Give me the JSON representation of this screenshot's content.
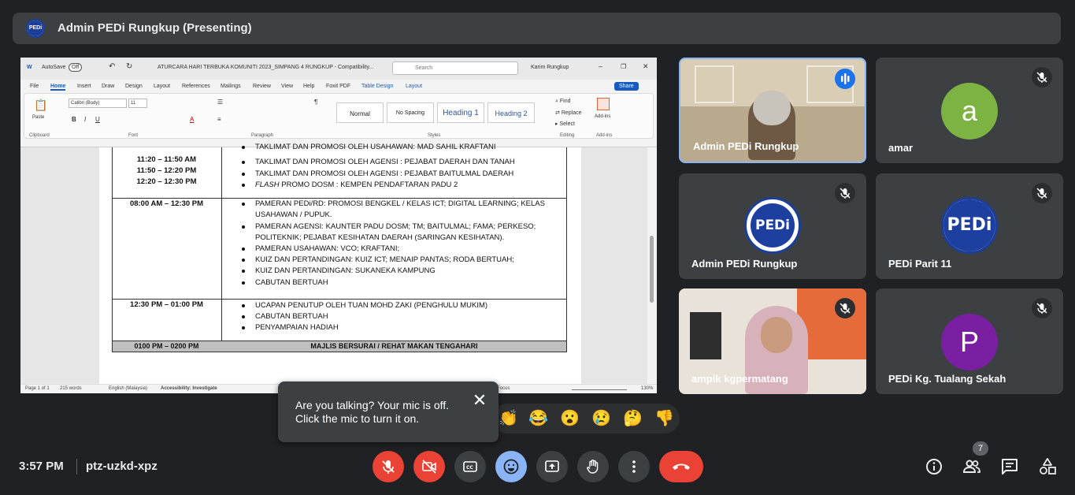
{
  "presenter_bar": {
    "logo_text": "PEDi",
    "title": "Admin PEDi Rungkup (Presenting)"
  },
  "word": {
    "autosave_label": "AutoSave",
    "autosave_state": "Off",
    "doc_title": "ATURCARA HARI TERBUKA KOMUNITI 2023_SIMPANG 4 RUNGKUP  -  Compatibility...",
    "search_placeholder": "Search",
    "user": "Karim Rungkup",
    "menu": [
      "File",
      "Home",
      "Insert",
      "Draw",
      "Design",
      "Layout",
      "References",
      "Mailings",
      "Review",
      "View",
      "Help",
      "Foxit PDF",
      "Table Design",
      "Layout"
    ],
    "share_label": "Share",
    "font_name": "Calibri (Body)",
    "font_size": "11",
    "paste_label": "Paste",
    "styles": [
      "Normal",
      "No Spacing",
      "Heading 1",
      "Heading 2"
    ],
    "find_label": "Find",
    "replace_label": "Replace",
    "select_label": "Select",
    "addins_label": "Add-ins",
    "groups": [
      "Clipboard",
      "Font",
      "Paragraph",
      "Styles",
      "Editing",
      "Add-ins"
    ],
    "rows": [
      {
        "times": [
          "11:20 – 11:50 AM",
          "11:50 – 12:20 PM",
          "12:20 – 12:30 PM"
        ],
        "items": [
          "TAKLIMAT DAN PROMOSI OLEH USAHAWAN: MAD SAHIL KRAFTANI",
          "TAKLIMAT DAN PROMOSI OLEH AGENSI : PEJABAT DAERAH DAN TANAH",
          "TAKLIMAT DAN PROMOSI OLEH AGENSI : PEJABAT BAITULMAL DAERAH",
          "PROMO DOSM : KEMPEN PENDAFTARAN PADU 2"
        ],
        "italic_prefix": "FLASH"
      },
      {
        "times": [
          "08:00 AM – 12:30 PM"
        ],
        "items": [
          "PAMERAN PEDi/RD: PROMOSI BENGKEL / KELAS ICT; DIGITAL LEARNING; KELAS",
          "USAHAWAN / PUPUK.",
          "PAMERAN AGENSI: KAUNTER PADU DOSM; TM; BAITULMAL; FAMA; PERKESO;",
          "POLITEKNIK; PEJABAT KESIHATAN DAERAH (SARINGAN KESIHATAN).",
          "PAMERAN USAHAWAN: VCO; KRAFTANI;",
          "KUIZ DAN PERTANDINGAN: KUIZ ICT; MENAIP PANTAS; RODA BERTUAH;",
          "KUIZ DAN PERTANDINGAN: SUKANEKA KAMPUNG",
          "CABUTAN BERTUAH"
        ]
      },
      {
        "times": [
          "12:30 PM – 01:00 PM"
        ],
        "items": [
          "UCAPAN PENUTUP OLEH TUAN MOHD ZAKI (PENGHULU MUKIM)",
          "CABUTAN BERTUAH",
          "PENYAMPAIAN HADIAH"
        ]
      },
      {
        "times": [
          "0100 PM – 0200 PM"
        ],
        "items": [
          "MAJLIS BERSURAI / REHAT MAKAN TENGAHARI"
        ]
      }
    ],
    "status": {
      "page": "Page 1 of 1",
      "words": "215 words",
      "language": "English (Malaysia)",
      "accessibility": "Accessibility: Investigate",
      "focus": "Focus",
      "zoom": "130%"
    }
  },
  "participants": [
    {
      "name": "Admin PEDi Rungkup",
      "type": "video",
      "speaking": true
    },
    {
      "name": "amar",
      "type": "avatar",
      "initial": "a",
      "color": "#7cb342"
    },
    {
      "name": "Admin PEDi Rungkup",
      "type": "logo",
      "logo_text": "PEDi"
    },
    {
      "name": "PEDi Parit 11",
      "type": "logo",
      "logo_text": "PEDi"
    },
    {
      "name": "ampik kgpermatang",
      "type": "video"
    },
    {
      "name": "PEDi Kg. Tualang Sekah",
      "type": "avatar",
      "initial": "P",
      "color": "#7b1fa2"
    }
  ],
  "mic_popup": {
    "message": "Are you talking? Your mic is off. Click the mic to turn it on.",
    "close_glyph": "✕"
  },
  "reactions": [
    "👏",
    "😂",
    "😮",
    "😢",
    "🤔",
    "👎"
  ],
  "bottom": {
    "time": "3:57 PM",
    "meeting_code": "ptz-uzkd-xpz",
    "people_count": "7"
  }
}
